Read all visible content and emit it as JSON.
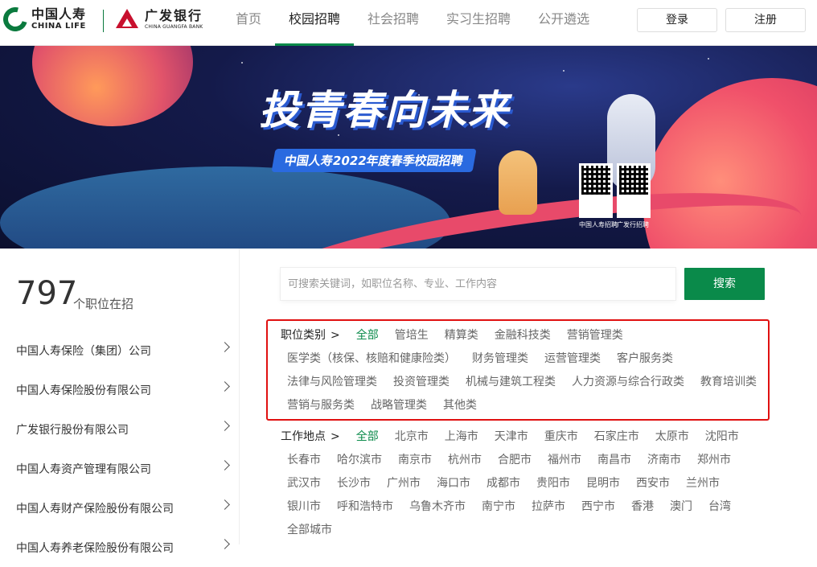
{
  "header": {
    "logo_life_cn": "中国人寿",
    "logo_life_en": "CHINA LIFE",
    "logo_bank_cn": "广发银行",
    "logo_bank_en": "CHINA GUANGFA BANK",
    "nav": [
      {
        "label": "首页",
        "active": false
      },
      {
        "label": "校园招聘",
        "active": true
      },
      {
        "label": "社会招聘",
        "active": false
      },
      {
        "label": "实习生招聘",
        "active": false
      },
      {
        "label": "公开遴选",
        "active": false
      }
    ],
    "login": "登录",
    "register": "注册"
  },
  "banner": {
    "title": "投青春向未来",
    "subtitle": "中国人寿2022年度春季校园招聘",
    "qr_labels": [
      "中国人寿招聘",
      "广发行招聘"
    ]
  },
  "summary": {
    "count": "797",
    "count_label": "个职位在招"
  },
  "companies": [
    "中国人寿保险（集团）公司",
    "中国人寿保险股份有限公司",
    "广发银行股份有限公司",
    "中国人寿资产管理有限公司",
    "中国人寿财产保险股份有限公司",
    "中国人寿养老保险股份有限公司"
  ],
  "search": {
    "placeholder": "可搜索关键词，如职位名称、专业、工作内容",
    "button": "搜索"
  },
  "job_category": {
    "title": "职位类别",
    "arrow": ">",
    "rows": [
      [
        "全部",
        "管培生",
        "精算类",
        "金融科技类",
        "营销管理类"
      ],
      [
        "医学类（核保、核赔和健康险类）",
        "财务管理类",
        "运营管理类",
        "客户服务类"
      ],
      [
        "法律与风险管理类",
        "投资管理类",
        "机械与建筑工程类",
        "人力资源与综合行政类",
        "教育培训类"
      ],
      [
        "营销与服务类",
        "战略管理类",
        "其他类"
      ]
    ],
    "selected": "全部"
  },
  "location": {
    "title": "工作地点",
    "arrow": ">",
    "rows": [
      [
        "全部",
        "北京市",
        "上海市",
        "天津市",
        "重庆市",
        "石家庄市",
        "太原市",
        "沈阳市"
      ],
      [
        "长春市",
        "哈尔滨市",
        "南京市",
        "杭州市",
        "合肥市",
        "福州市",
        "南昌市",
        "济南市",
        "郑州市"
      ],
      [
        "武汉市",
        "长沙市",
        "广州市",
        "海口市",
        "成都市",
        "贵阳市",
        "昆明市",
        "西安市",
        "兰州市"
      ],
      [
        "银川市",
        "呼和浩特市",
        "乌鲁木齐市",
        "南宁市",
        "拉萨市",
        "西宁市",
        "香港",
        "澳门",
        "台湾"
      ],
      [
        "全部城市"
      ]
    ],
    "selected": "全部"
  },
  "colors": {
    "brand_green": "#0a8a4a",
    "highlight_red": "#e01010"
  }
}
